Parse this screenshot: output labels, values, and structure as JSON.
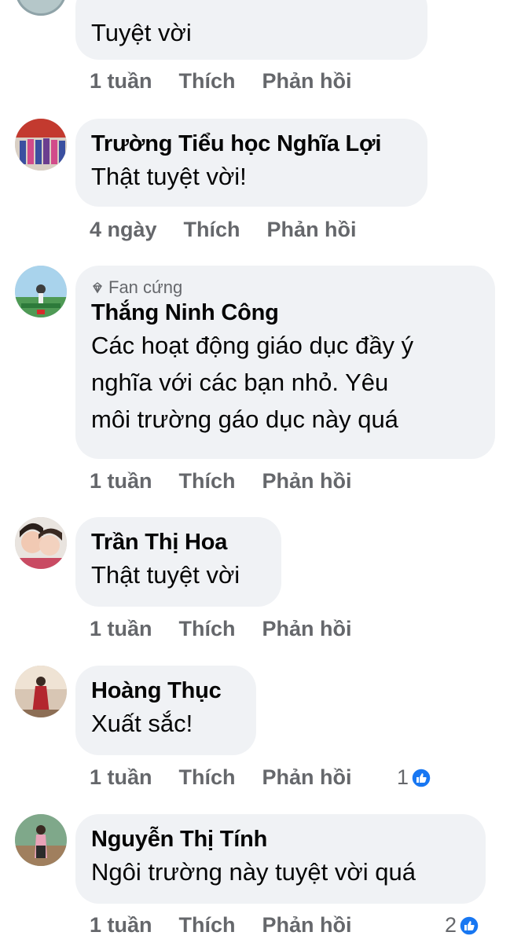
{
  "comments": [
    {
      "text": "Tuyệt vời",
      "time": "1 tuần",
      "like": "Thích",
      "reply": "Phản hồi"
    },
    {
      "name": "Trường Tiểu học Nghĩa Lợi",
      "text": "Thật tuyệt vời!",
      "time": "4 ngày",
      "like": "Thích",
      "reply": "Phản hồi"
    },
    {
      "badge": "Fan cứng",
      "name": "Thắng Ninh Công",
      "text_lines": [
        "Các hoạt động giáo dục đầy ý",
        "nghĩa với các bạn nhỏ. Yêu",
        "môi trường gáo dục này quá"
      ],
      "time": "1 tuần",
      "like": "Thích",
      "reply": "Phản hồi"
    },
    {
      "name": "Trần Thị Hoa",
      "text": "Thật tuyệt vời",
      "time": "1 tuần",
      "like": "Thích",
      "reply": "Phản hồi"
    },
    {
      "name": "Hoàng Thục",
      "text": "Xuất sắc!",
      "time": "1 tuần",
      "like": "Thích",
      "reply": "Phản hồi",
      "reactions": "1"
    },
    {
      "name": "Nguyễn Thị Tính",
      "text": "Ngôi trường này tuyệt vời quá",
      "time": "1 tuần",
      "like": "Thích",
      "reply": "Phản hồi",
      "reactions": "2"
    }
  ],
  "colors": {
    "bubble": "#f0f2f5",
    "muted": "#65676b",
    "like_blue": "#1877f2"
  }
}
